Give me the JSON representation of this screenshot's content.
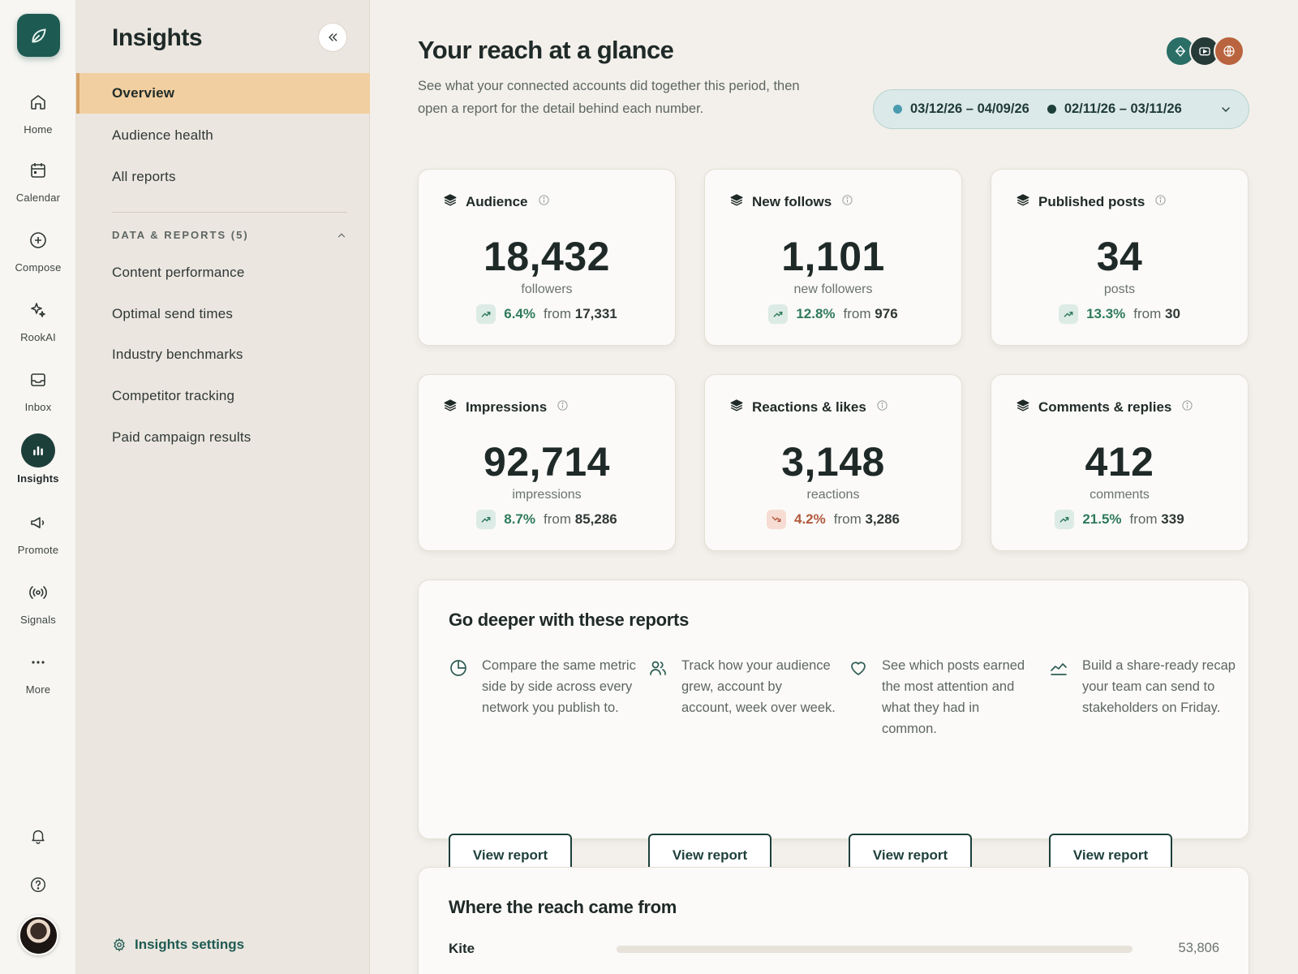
{
  "rail": {
    "items": [
      {
        "label": "Home",
        "icon": "home-icon"
      },
      {
        "label": "Calendar",
        "icon": "calendar-icon"
      },
      {
        "label": "Compose",
        "icon": "plus-circle-icon"
      },
      {
        "label": "RookAI",
        "icon": "sparkle-icon"
      },
      {
        "label": "Inbox",
        "icon": "inbox-icon"
      },
      {
        "label": "Insights",
        "icon": "bar-chart-icon",
        "active": true
      },
      {
        "label": "Promote",
        "icon": "megaphone-icon"
      },
      {
        "label": "Signals",
        "icon": "broadcast-icon"
      },
      {
        "label": "More",
        "icon": "more-dots-icon"
      }
    ]
  },
  "subnav": {
    "title": "Insights",
    "items": [
      "Overview",
      "Audience health",
      "All reports"
    ],
    "section_label": "DATA & REPORTS (5)",
    "reports": [
      "Content performance",
      "Optimal send times",
      "Industry benchmarks",
      "Competitor tracking",
      "Paid campaign results"
    ],
    "settings_label": "Insights settings"
  },
  "header": {
    "title": "Your reach at a glance",
    "subtitle": "See what your connected accounts did together this period, then open a report for the detail behind each number.",
    "range_current": "03/12/26 – 04/09/26",
    "range_previous": "02/11/26 – 03/11/26"
  },
  "colors": {
    "accent": "#1d5a52",
    "active_nav": "#f2cfa0",
    "current_dot": "#4a9bb0",
    "previous_dot": "#1d3f3a",
    "up": "#2f7a5c",
    "down": "#b25a3e"
  },
  "stats": [
    {
      "label": "Audience",
      "value": "18,432",
      "unit": "followers",
      "delta": "6.4%",
      "direction": "up",
      "from_word": "from",
      "from_value": "17,331"
    },
    {
      "label": "New follows",
      "value": "1,101",
      "unit": "new followers",
      "delta": "12.8%",
      "direction": "up",
      "from_word": "from",
      "from_value": "976"
    },
    {
      "label": "Published posts",
      "value": "34",
      "unit": "posts",
      "delta": "13.3%",
      "direction": "up",
      "from_word": "from",
      "from_value": "30"
    },
    {
      "label": "Impressions",
      "value": "92,714",
      "unit": "impressions",
      "delta": "8.7%",
      "direction": "up",
      "from_word": "from",
      "from_value": "85,286"
    },
    {
      "label": "Reactions & likes",
      "value": "3,148",
      "unit": "reactions",
      "delta": "4.2%",
      "direction": "down",
      "from_word": "from",
      "from_value": "3,286"
    },
    {
      "label": "Comments & replies",
      "value": "412",
      "unit": "comments",
      "delta": "21.5%",
      "direction": "up",
      "from_word": "from",
      "from_value": "339"
    }
  ],
  "reports_panel": {
    "title": "Go deeper with these reports",
    "reports": [
      {
        "icon": "clock-chart-icon",
        "text": "Compare the same metric side by side across every network you publish to.",
        "button": "View report"
      },
      {
        "icon": "users-icon",
        "text": "Track how your audience grew, account by account, week over week.",
        "button": "View report"
      },
      {
        "icon": "heart-icon",
        "text": "See which posts earned the most attention and what they had in common.",
        "button": "View report"
      },
      {
        "icon": "line-trend-icon",
        "text": "Build a share-ready recap your team can send to stakeholders on Friday.",
        "button": "View report"
      }
    ]
  },
  "sources_panel": {
    "title": "Where the reach came from",
    "rows": [
      {
        "name": "Kite",
        "value": "53,806"
      }
    ]
  }
}
